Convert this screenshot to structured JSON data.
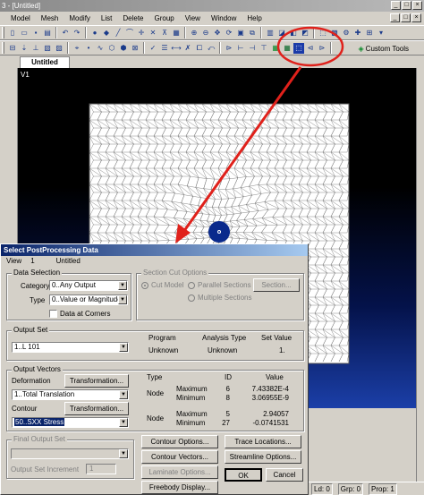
{
  "window": {
    "title": "3 - [Untitled]",
    "controls": [
      "_",
      "□",
      "×"
    ]
  },
  "menu": [
    "Model",
    "Mesh",
    "Modify",
    "List",
    "Delete",
    "Group",
    "View",
    "Window",
    "Help"
  ],
  "toolbar": {
    "custom_tools_label": "Custom Tools"
  },
  "tab": {
    "label": "Untitled"
  },
  "viewport": {
    "label": "V1"
  },
  "status": {
    "ld": "Ld: 0",
    "grp": "Grp: 0",
    "prop": "Prop: 1"
  },
  "colors": {
    "annotation": "#e0211b",
    "dialog_title": "#0a246a",
    "hole": "#0a2a8c",
    "mesh_bg": "#ffffff"
  },
  "dialog": {
    "title": "Select PostProcessing Data",
    "menu": {
      "view": "View",
      "view_num": "1",
      "view_name": "Untitled"
    },
    "data_selection": {
      "title": "Data Selection",
      "category_label": "Category",
      "category_value": "0..Any Output",
      "type_label": "Type",
      "type_value": "0..Value or Magnitude",
      "data_at_corners_label": "Data at Corners",
      "data_at_corners_checked": false
    },
    "section_cut": {
      "title": "Section Cut Options",
      "cut_model": "Cut Model",
      "parallel": "Parallel Sections",
      "multiple": "Multiple Sections",
      "section_button": "Section..."
    },
    "output_set": {
      "title": "Output Set",
      "value": "1..L 101",
      "headers": [
        "Program",
        "Analysis Type",
        "Set Value"
      ],
      "row": [
        "Unknown",
        "Unknown",
        "1."
      ]
    },
    "output_vectors": {
      "title": "Output Vectors",
      "deformation_label": "Deformation",
      "deformation_value": "1..Total Translation",
      "contour_label": "Contour",
      "contour_value": "50..SXX Stress",
      "transformation_label": "Transformation...",
      "headers": [
        "Type",
        "ID",
        "Value"
      ],
      "rows": [
        {
          "type": "Node",
          "stat": "Maximum",
          "id": "6",
          "value": "7.43382E-4"
        },
        {
          "type": "",
          "stat": "Minimum",
          "id": "8",
          "value": "3.06955E-9"
        },
        {
          "type": "Node",
          "stat": "Maximum",
          "id": "5",
          "value": "2.94057"
        },
        {
          "type": "",
          "stat": "Minimum",
          "id": "27",
          "value": "-0.0741531"
        }
      ]
    },
    "final_output": {
      "title": "Final Output Set",
      "increment_label": "Output Set Increment",
      "increment_value": "1"
    },
    "buttons": {
      "contour_options": "Contour Options...",
      "trace_locations": "Trace Locations...",
      "contour_vectors": "Contour Vectors...",
      "streamline_options": "Streamline Options...",
      "laminate_options": "Laminate Options...",
      "freebody_display": "Freebody Display...",
      "ok": "OK",
      "cancel": "Cancel"
    }
  }
}
